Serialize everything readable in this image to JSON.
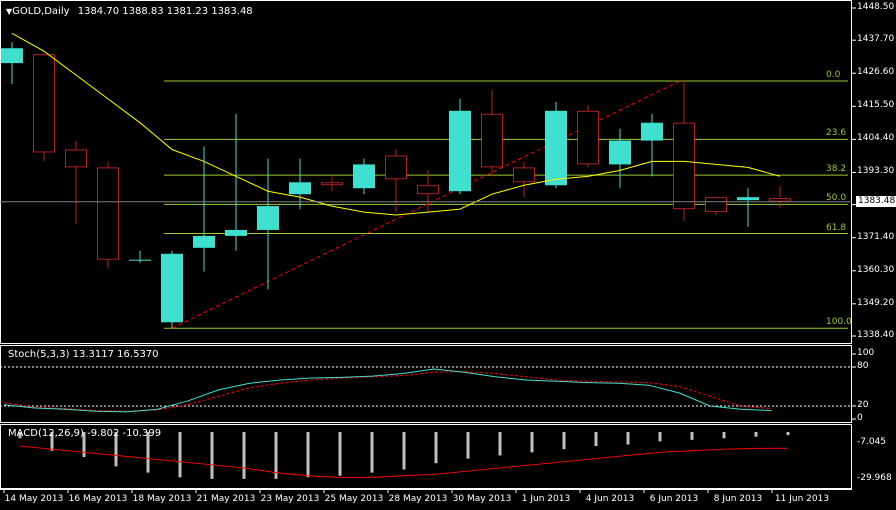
{
  "header": {
    "menu_glyph": "▼",
    "symbol_timeframe": "GOLD,Daily",
    "ohlc": "1384.70 1388.83 1381.23 1383.48"
  },
  "colors": {
    "background": "#000000",
    "axis": "#ffffff",
    "bull_candle": "#40e0d0",
    "bear_candle": "#b22222",
    "ma_line": "#ffff00",
    "fib_line": "#9acd32",
    "trend_line": "#ff0000",
    "stoch_main": "#40e0d0",
    "stoch_signal": "#ff0000",
    "macd_hist": "#c0c0c0",
    "macd_signal": "#ff0000"
  },
  "chart_data": {
    "type": "candlestick",
    "price_axis": {
      "ticks": [
        "1448.50",
        "1437.70",
        "1426.60",
        "1415.50",
        "1404.40",
        "1393.30",
        "1382.50",
        "1371.40",
        "1360.30",
        "1349.20",
        "1338.40"
      ],
      "ylim": [
        1338.4,
        1448.5
      ],
      "current_price": "1383.48"
    },
    "candles": [
      {
        "o": 1430,
        "h": 1437,
        "l": 1423,
        "c": 1435
      },
      {
        "o": 1433,
        "h": 1433,
        "l": 1397,
        "c": 1400
      },
      {
        "o": 1401,
        "h": 1404,
        "l": 1376,
        "c": 1395
      },
      {
        "o": 1395,
        "h": 1397,
        "l": 1361,
        "c": 1364
      },
      {
        "o": 1364,
        "h": 1367,
        "l": 1363,
        "c": 1364
      },
      {
        "o": 1343,
        "h": 1367,
        "l": 1341,
        "c": 1366
      },
      {
        "o": 1368,
        "h": 1402,
        "l": 1360,
        "c": 1372
      },
      {
        "o": 1372,
        "h": 1413,
        "l": 1367,
        "c": 1374
      },
      {
        "o": 1374,
        "h": 1398,
        "l": 1354,
        "c": 1382
      },
      {
        "o": 1386,
        "h": 1398,
        "l": 1381,
        "c": 1390
      },
      {
        "o": 1390,
        "h": 1392,
        "l": 1387,
        "c": 1389
      },
      {
        "o": 1388,
        "h": 1398,
        "l": 1386,
        "c": 1396
      },
      {
        "o": 1399,
        "h": 1401,
        "l": 1380,
        "c": 1391
      },
      {
        "o": 1389,
        "h": 1394,
        "l": 1380,
        "c": 1386
      },
      {
        "o": 1387,
        "h": 1418,
        "l": 1386,
        "c": 1414
      },
      {
        "o": 1413,
        "h": 1421,
        "l": 1392,
        "c": 1395
      },
      {
        "o": 1395,
        "h": 1397,
        "l": 1385,
        "c": 1390
      },
      {
        "o": 1389,
        "h": 1417,
        "l": 1388,
        "c": 1414
      },
      {
        "o": 1414,
        "h": 1416,
        "l": 1395,
        "c": 1396
      },
      {
        "o": 1396,
        "h": 1408,
        "l": 1388,
        "c": 1404
      },
      {
        "o": 1404,
        "h": 1413,
        "l": 1392,
        "c": 1410
      },
      {
        "o": 1410,
        "h": 1424,
        "l": 1377,
        "c": 1381
      },
      {
        "o": 1385,
        "h": 1385,
        "l": 1379,
        "c": 1380
      },
      {
        "o": 1384,
        "h": 1388,
        "l": 1375,
        "c": 1385
      },
      {
        "o": 1384.7,
        "h": 1388.83,
        "l": 1381.23,
        "c": 1383.48
      }
    ],
    "moving_average": [
      1440,
      1434,
      1426,
      1418,
      1410,
      1401,
      1397,
      1392,
      1387,
      1385,
      1382,
      1380,
      1379,
      1380,
      1381,
      1386,
      1389,
      1391,
      1392,
      1394,
      1397,
      1397,
      1396,
      1395,
      1392
    ],
    "fibonacci": [
      {
        "label": "0.0",
        "value": 1424.0
      },
      {
        "label": "23.6",
        "value": 1404.4
      },
      {
        "label": "38.2",
        "value": 1392.4
      },
      {
        "label": "50.0",
        "value": 1382.6
      },
      {
        "label": "61.8",
        "value": 1372.8
      },
      {
        "label": "100.0",
        "value": 1341.0
      }
    ],
    "stochastic": {
      "title": "Stoch(5,3,3) 13.3117 16.5370",
      "ticks": [
        "100",
        "80",
        "20",
        "0"
      ],
      "main": [
        22,
        17,
        15,
        12,
        11,
        15,
        28,
        45,
        55,
        60,
        63,
        64,
        66,
        70,
        77,
        72,
        65,
        60,
        58,
        56,
        55,
        52,
        40,
        20,
        15,
        13
      ],
      "signal": [
        25,
        18,
        16,
        13,
        12,
        14,
        22,
        35,
        48,
        55,
        60,
        63,
        65,
        67,
        72,
        73,
        70,
        65,
        60,
        58,
        57,
        56,
        50,
        35,
        20,
        16
      ]
    },
    "macd": {
      "title": "MACD(12,26,9) -9.802 -10.399",
      "ticks": [
        "-7.045",
        "-29.968"
      ],
      "histogram": [
        -4,
        -12,
        -16,
        -22,
        -26,
        -29,
        -30,
        -30,
        -30,
        -29,
        -28,
        -26,
        -24,
        -20,
        -17,
        -15,
        -13,
        -11,
        -9,
        -8,
        -6,
        -5,
        -4,
        -3,
        -2
      ],
      "signal": [
        -9,
        -11,
        -13,
        -15,
        -17,
        -19,
        -21,
        -23,
        -26,
        -28,
        -29,
        -29,
        -28,
        -27,
        -25,
        -23,
        -21,
        -19,
        -17,
        -15,
        -13,
        -12,
        -11,
        -10.5,
        -10.4
      ]
    },
    "dates": [
      "14 May 2013",
      "16 May 2013",
      "18 May 2013",
      "21 May 2013",
      "23 May 2013",
      "25 May 2013",
      "28 May 2013",
      "30 May 2013",
      "1 Jun 2013",
      "4 Jun 2013",
      "6 Jun 2013",
      "8 Jun 2013",
      "11 Jun 2013"
    ]
  }
}
